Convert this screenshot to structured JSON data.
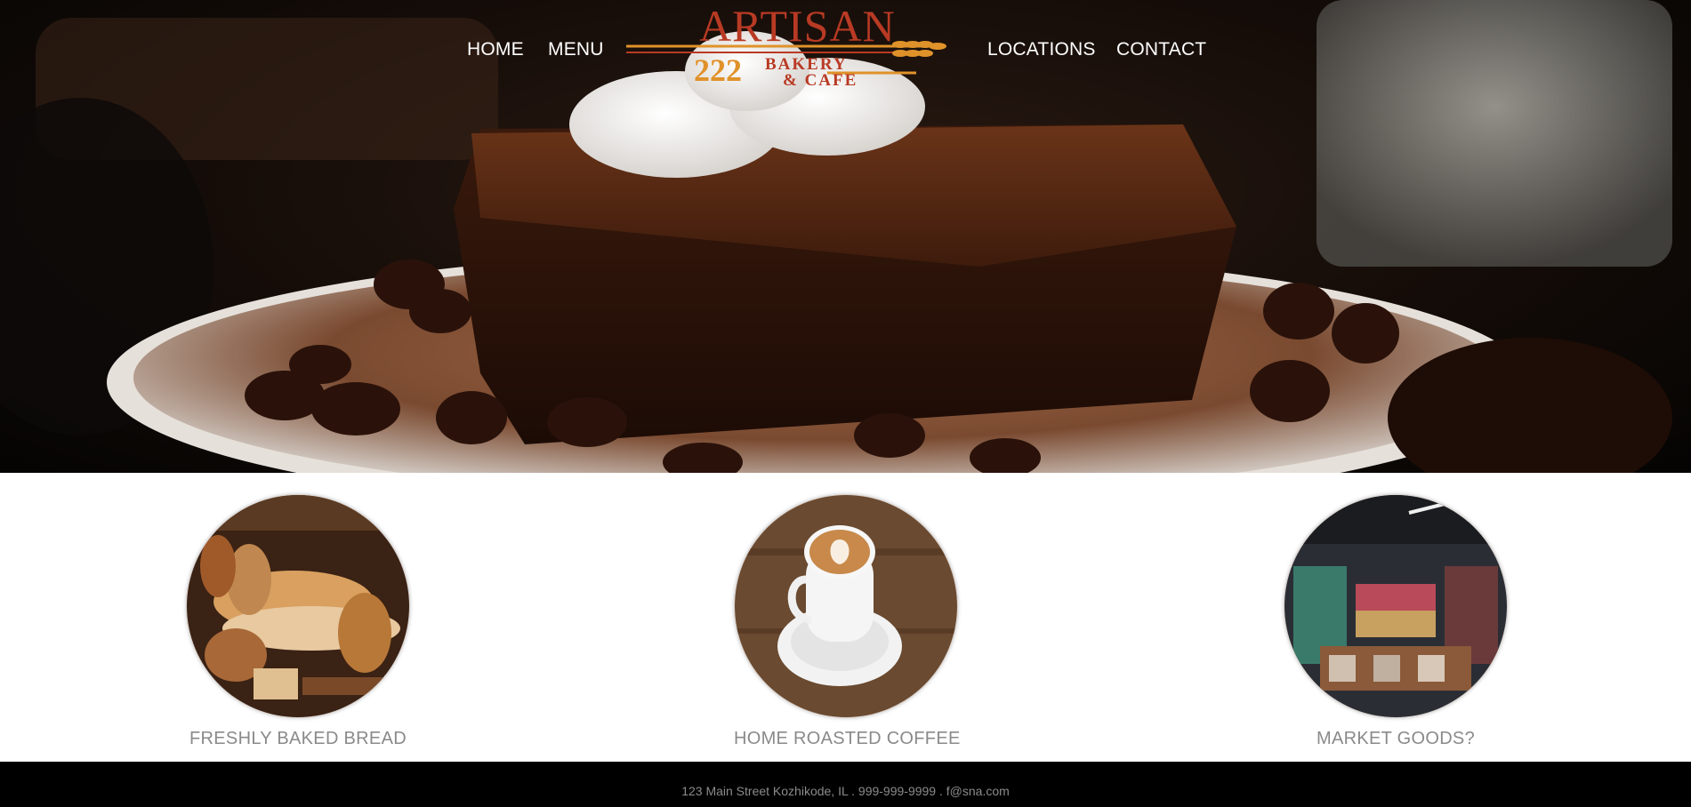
{
  "nav": {
    "home": "HOME",
    "menu": "MENU",
    "locations": "LOCATIONS",
    "contact": "CONTACT"
  },
  "logo": {
    "title": "ARTISAN",
    "number": "222",
    "line1": "BAKERY",
    "line2": "& CAFE",
    "colors": {
      "red": "#b93a24",
      "orange": "#e0922a"
    }
  },
  "hero": {
    "image": "chocolate-brownie-with-whipped-cream-photo"
  },
  "features": [
    {
      "caption": "FRESHLY BAKED BREAD",
      "image": "bread-assortment-photo"
    },
    {
      "caption": "HOME ROASTED COFFEE",
      "image": "latte-cup-photo"
    },
    {
      "caption": "MARKET GOODS?",
      "image": "market-shelves-photo"
    }
  ],
  "footer": {
    "address": "123 Main Street Kozhikode, IL . 999-999-9999 . f@sna.com"
  }
}
